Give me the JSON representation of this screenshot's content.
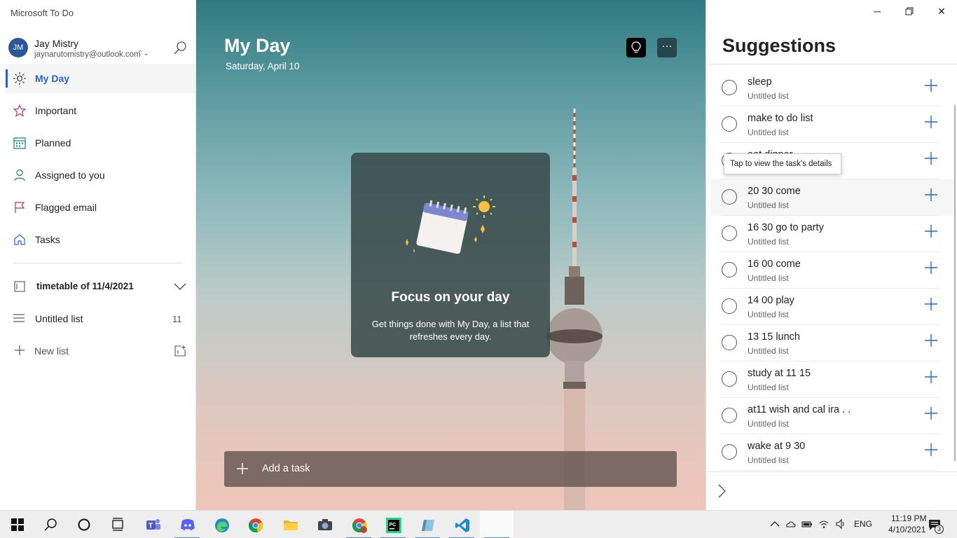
{
  "app": {
    "title": "Microsoft To Do"
  },
  "account": {
    "initials": "JM",
    "name": "Jay Mistry",
    "email": "jaynarutomistry@outlook.com"
  },
  "nav": {
    "items": [
      {
        "label": "My Day",
        "icon": "sun-icon",
        "active": true
      },
      {
        "label": "Important",
        "icon": "star-icon"
      },
      {
        "label": "Planned",
        "icon": "calendar-icon"
      },
      {
        "label": "Assigned to you",
        "icon": "person-icon"
      },
      {
        "label": "Flagged email",
        "icon": "flag-icon"
      },
      {
        "label": "Tasks",
        "icon": "home-icon"
      }
    ],
    "group": {
      "label": "timetable of 11/4/2021"
    },
    "list": {
      "label": "Untitled list",
      "count": "11"
    },
    "new_list": {
      "label": "New list"
    }
  },
  "main": {
    "title": "My Day",
    "date": "Saturday, April 10",
    "focus_title": "Focus on your day",
    "focus_desc": "Get things done with My Day, a list that refreshes every day.",
    "add_task": "Add a task"
  },
  "suggestions": {
    "title": "Suggestions",
    "tooltip": "Tap to view the task's details",
    "items": [
      {
        "title": "sleep",
        "list": "Untitled list"
      },
      {
        "title": "make to do list",
        "list": "Untitled list"
      },
      {
        "title": "eat dinner",
        "list": "Untitled list"
      },
      {
        "title": "20 30 come",
        "list": "Untitled list"
      },
      {
        "title": "16 30 go to party",
        "list": "Untitled list"
      },
      {
        "title": "16 00 come",
        "list": "Untitled list"
      },
      {
        "title": "14 00 play",
        "list": "Untitled list"
      },
      {
        "title": "13 15 lunch",
        "list": "Untitled list"
      },
      {
        "title": "study at 11 15",
        "list": "Untitled list"
      },
      {
        "title": "at11 wish and cal ira . .",
        "list": "Untitled list"
      },
      {
        "title": "wake at 9 30",
        "list": "Untitled list"
      }
    ]
  },
  "taskbar": {
    "lang": "ENG",
    "time": "11:19 PM",
    "date": "4/10/2021",
    "notification_count": "3"
  },
  "colors": {
    "accent": "#2564cf",
    "suggestion_plus": "#2564cf"
  }
}
